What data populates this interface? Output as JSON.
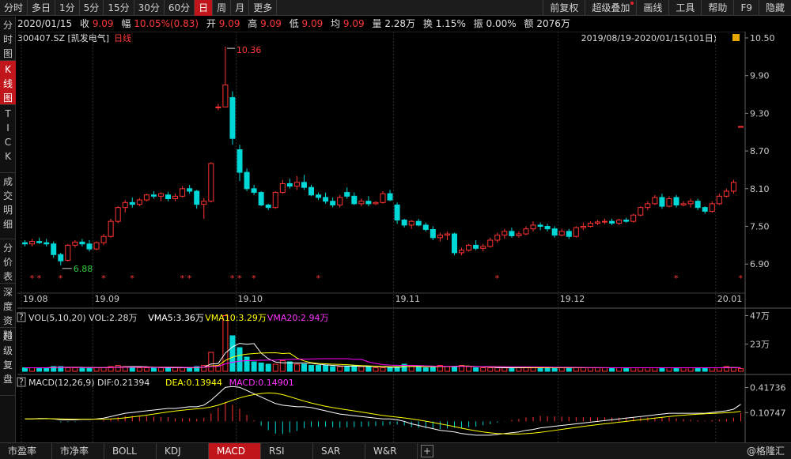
{
  "toolbar": {
    "periods": [
      "分时",
      "多日",
      "1分",
      "5分",
      "15分",
      "30分",
      "60分",
      "日",
      "周",
      "月",
      "更多"
    ],
    "active_period": "日",
    "right": [
      "前复权",
      "超级叠加",
      "画线",
      "工具",
      "帮助",
      "F9",
      "隐藏"
    ]
  },
  "left_tabs": [
    {
      "label": "分时图",
      "active": false
    },
    {
      "label": "K线图",
      "active": true
    },
    {
      "label": "TICK",
      "active": false
    },
    {
      "label": "成交明细",
      "active": false
    },
    {
      "label": "分价表",
      "active": false
    },
    {
      "label": "深度资料",
      "active": false
    },
    {
      "label": "超级复盘",
      "active": false
    }
  ],
  "info": {
    "date": "2020/01/15",
    "close_label": "收",
    "close": "9.09",
    "change_label": "幅",
    "change": "10.05%(0.83)",
    "open_label": "开",
    "open": "9.09",
    "high_label": "高",
    "high": "9.09",
    "low_label": "低",
    "low": "9.09",
    "avg_label": "均",
    "avg": "9.09",
    "vol_label": "量",
    "vol": "2.28万",
    "turnover_label": "换",
    "turnover": "1.15%",
    "amp_label": "振",
    "amp": "0.00%",
    "amount_label": "额",
    "amount": "2076万"
  },
  "stock": {
    "code": "300407.SZ",
    "name": "[凯发电气]",
    "period": "日线",
    "range": "2019/08/19-2020/01/15(101日)"
  },
  "colors": {
    "up": "#ff3333",
    "down": "#00d8d8",
    "ma5": "#ffffff",
    "ma10": "#ffff00",
    "ma20": "#ff00ff",
    "active": "#c0161b"
  },
  "chart_data": [
    {
      "type": "candlestick",
      "title": "日线",
      "yaxis_ticks": [
        "10.50",
        "9.90",
        "9.30",
        "8.70",
        "8.10",
        "7.50",
        "6.90"
      ],
      "ylim": [
        6.45,
        10.55
      ],
      "xaxis_ticks": [
        "19.08",
        "19.09",
        "19.10",
        "19.11",
        "19.12",
        "20.01"
      ],
      "annotations": [
        {
          "text": "10.36",
          "value": 10.36
        },
        {
          "text": "6.88",
          "value": 6.88
        }
      ],
      "series": [
        {
          "date": "19.08.19",
          "o": 7.24,
          "h": 7.28,
          "l": 7.18,
          "c": 7.22
        },
        {
          "date": "19.08.20",
          "o": 7.22,
          "h": 7.3,
          "l": 7.18,
          "c": 7.26
        },
        {
          "date": "19.08.21",
          "o": 7.26,
          "h": 7.32,
          "l": 7.22,
          "c": 7.24
        },
        {
          "date": "19.08.22",
          "o": 7.24,
          "h": 7.3,
          "l": 7.18,
          "c": 7.22
        },
        {
          "date": "19.08.23",
          "o": 7.22,
          "h": 7.26,
          "l": 7.0,
          "c": 7.05
        },
        {
          "date": "19.08.26",
          "o": 7.05,
          "h": 7.08,
          "l": 6.88,
          "c": 6.95
        },
        {
          "date": "19.08.27",
          "o": 6.96,
          "h": 7.22,
          "l": 6.94,
          "c": 7.2
        },
        {
          "date": "19.08.28",
          "o": 7.2,
          "h": 7.28,
          "l": 7.16,
          "c": 7.25
        },
        {
          "date": "19.08.29",
          "o": 7.25,
          "h": 7.3,
          "l": 7.18,
          "c": 7.22
        },
        {
          "date": "19.08.30",
          "o": 7.22,
          "h": 7.28,
          "l": 7.1,
          "c": 7.14
        },
        {
          "date": "19.09.02",
          "o": 7.14,
          "h": 7.26,
          "l": 7.12,
          "c": 7.24
        },
        {
          "date": "19.09.03",
          "o": 7.24,
          "h": 7.38,
          "l": 7.2,
          "c": 7.34
        },
        {
          "date": "19.09.04",
          "o": 7.34,
          "h": 7.62,
          "l": 7.32,
          "c": 7.58
        },
        {
          "date": "19.09.05",
          "o": 7.58,
          "h": 7.82,
          "l": 7.55,
          "c": 7.8
        },
        {
          "date": "19.09.06",
          "o": 7.8,
          "h": 7.92,
          "l": 7.72,
          "c": 7.88
        },
        {
          "date": "19.09.09",
          "o": 7.88,
          "h": 7.96,
          "l": 7.8,
          "c": 7.85
        },
        {
          "date": "19.09.10",
          "o": 7.85,
          "h": 7.95,
          "l": 7.82,
          "c": 7.92
        },
        {
          "date": "19.09.11",
          "o": 7.92,
          "h": 8.02,
          "l": 7.9,
          "c": 8.0
        },
        {
          "date": "19.09.12",
          "o": 8.0,
          "h": 8.06,
          "l": 7.94,
          "c": 7.98
        },
        {
          "date": "19.09.16",
          "o": 7.98,
          "h": 8.04,
          "l": 7.9,
          "c": 8.02
        },
        {
          "date": "19.09.17",
          "o": 8.0,
          "h": 8.05,
          "l": 7.9,
          "c": 7.94
        },
        {
          "date": "19.09.18",
          "o": 7.94,
          "h": 8.02,
          "l": 7.9,
          "c": 7.98
        },
        {
          "date": "19.09.19",
          "o": 7.98,
          "h": 8.14,
          "l": 7.96,
          "c": 8.1
        },
        {
          "date": "19.09.20",
          "o": 8.1,
          "h": 8.16,
          "l": 8.02,
          "c": 8.06
        },
        {
          "date": "19.09.23",
          "o": 8.06,
          "h": 8.08,
          "l": 7.78,
          "c": 7.85
        },
        {
          "date": "19.09.24",
          "o": 7.85,
          "h": 7.95,
          "l": 7.62,
          "c": 7.9
        },
        {
          "date": "19.09.25",
          "o": 7.9,
          "h": 8.52,
          "l": 7.88,
          "c": 8.5
        },
        {
          "date": "19.09.26",
          "o": 9.4,
          "h": 9.45,
          "l": 9.35,
          "c": 9.4
        },
        {
          "date": "19.09.27",
          "o": 9.4,
          "h": 10.36,
          "l": 9.4,
          "c": 9.75
        },
        {
          "date": "19.09.30",
          "o": 9.55,
          "h": 9.65,
          "l": 8.8,
          "c": 8.9
        },
        {
          "date": "19.10.08",
          "o": 8.72,
          "h": 8.8,
          "l": 8.22,
          "c": 8.36
        },
        {
          "date": "19.10.09",
          "o": 8.36,
          "h": 8.42,
          "l": 8.06,
          "c": 8.1
        },
        {
          "date": "19.10.10",
          "o": 8.1,
          "h": 8.16,
          "l": 8.0,
          "c": 8.04
        },
        {
          "date": "19.10.11",
          "o": 8.04,
          "h": 8.06,
          "l": 7.82,
          "c": 7.84
        },
        {
          "date": "19.10.14",
          "o": 7.84,
          "h": 7.86,
          "l": 7.76,
          "c": 7.8
        },
        {
          "date": "19.10.15",
          "o": 7.8,
          "h": 8.06,
          "l": 7.78,
          "c": 8.04
        },
        {
          "date": "19.10.16",
          "o": 8.04,
          "h": 8.24,
          "l": 8.02,
          "c": 8.18
        },
        {
          "date": "19.10.17",
          "o": 8.18,
          "h": 8.26,
          "l": 8.1,
          "c": 8.14
        },
        {
          "date": "19.10.18",
          "o": 8.14,
          "h": 8.3,
          "l": 8.08,
          "c": 8.2
        },
        {
          "date": "19.10.21",
          "o": 8.2,
          "h": 8.32,
          "l": 8.08,
          "c": 8.12
        },
        {
          "date": "19.10.22",
          "o": 8.12,
          "h": 8.16,
          "l": 7.98,
          "c": 8.0
        },
        {
          "date": "19.10.23",
          "o": 8.0,
          "h": 8.04,
          "l": 7.92,
          "c": 7.96
        },
        {
          "date": "19.10.24",
          "o": 7.96,
          "h": 8.04,
          "l": 7.86,
          "c": 7.9
        },
        {
          "date": "19.10.25",
          "o": 7.9,
          "h": 7.96,
          "l": 7.8,
          "c": 7.84
        },
        {
          "date": "19.10.28",
          "o": 7.84,
          "h": 8.0,
          "l": 7.8,
          "c": 7.96
        },
        {
          "date": "19.10.29",
          "o": 8.04,
          "h": 8.12,
          "l": 7.94,
          "c": 7.98
        },
        {
          "date": "19.10.30",
          "o": 7.98,
          "h": 8.04,
          "l": 7.84,
          "c": 7.86
        },
        {
          "date": "19.10.31",
          "o": 7.86,
          "h": 7.94,
          "l": 7.82,
          "c": 7.9
        },
        {
          "date": "19.11.01",
          "o": 7.9,
          "h": 7.98,
          "l": 7.82,
          "c": 7.86
        },
        {
          "date": "19.11.04",
          "o": 7.86,
          "h": 7.9,
          "l": 7.84,
          "c": 7.88
        },
        {
          "date": "19.11.05",
          "o": 7.88,
          "h": 8.06,
          "l": 7.86,
          "c": 8.02
        },
        {
          "date": "19.11.06",
          "o": 8.02,
          "h": 8.08,
          "l": 7.9,
          "c": 7.92
        },
        {
          "date": "19.11.07",
          "o": 7.84,
          "h": 7.88,
          "l": 7.54,
          "c": 7.6
        },
        {
          "date": "19.11.08",
          "o": 7.6,
          "h": 7.62,
          "l": 7.48,
          "c": 7.52
        },
        {
          "date": "19.11.11",
          "o": 7.52,
          "h": 7.6,
          "l": 7.46,
          "c": 7.58
        },
        {
          "date": "19.11.12",
          "o": 7.58,
          "h": 7.62,
          "l": 7.5,
          "c": 7.52
        },
        {
          "date": "19.11.13",
          "o": 7.52,
          "h": 7.56,
          "l": 7.42,
          "c": 7.45
        },
        {
          "date": "19.11.14",
          "o": 7.45,
          "h": 7.5,
          "l": 7.28,
          "c": 7.32
        },
        {
          "date": "19.11.15",
          "o": 7.32,
          "h": 7.4,
          "l": 7.26,
          "c": 7.36
        },
        {
          "date": "19.11.18",
          "o": 7.36,
          "h": 7.42,
          "l": 7.28,
          "c": 7.38
        },
        {
          "date": "19.11.19",
          "o": 7.38,
          "h": 7.4,
          "l": 7.04,
          "c": 7.08
        },
        {
          "date": "19.11.20",
          "o": 7.08,
          "h": 7.16,
          "l": 7.04,
          "c": 7.12
        },
        {
          "date": "19.11.21",
          "o": 7.12,
          "h": 7.22,
          "l": 7.1,
          "c": 7.2
        },
        {
          "date": "19.11.22",
          "o": 7.2,
          "h": 7.28,
          "l": 7.12,
          "c": 7.15
        },
        {
          "date": "19.11.25",
          "o": 7.15,
          "h": 7.22,
          "l": 7.1,
          "c": 7.18
        },
        {
          "date": "19.11.26",
          "o": 7.18,
          "h": 7.32,
          "l": 7.16,
          "c": 7.28
        },
        {
          "date": "19.11.27",
          "o": 7.28,
          "h": 7.4,
          "l": 7.24,
          "c": 7.36
        },
        {
          "date": "19.11.28",
          "o": 7.36,
          "h": 7.46,
          "l": 7.3,
          "c": 7.42
        },
        {
          "date": "19.11.29",
          "o": 7.42,
          "h": 7.48,
          "l": 7.32,
          "c": 7.35
        },
        {
          "date": "19.12.02",
          "o": 7.35,
          "h": 7.42,
          "l": 7.32,
          "c": 7.38
        },
        {
          "date": "19.12.03",
          "o": 7.38,
          "h": 7.5,
          "l": 7.36,
          "c": 7.46
        },
        {
          "date": "19.12.04",
          "o": 7.46,
          "h": 7.58,
          "l": 7.42,
          "c": 7.52
        },
        {
          "date": "19.12.05",
          "o": 7.52,
          "h": 7.56,
          "l": 7.44,
          "c": 7.5
        },
        {
          "date": "19.12.06",
          "o": 7.5,
          "h": 7.54,
          "l": 7.42,
          "c": 7.46
        },
        {
          "date": "19.12.09",
          "o": 7.46,
          "h": 7.5,
          "l": 7.32,
          "c": 7.36
        },
        {
          "date": "19.12.10",
          "o": 7.36,
          "h": 7.46,
          "l": 7.34,
          "c": 7.42
        },
        {
          "date": "19.12.11",
          "o": 7.42,
          "h": 7.46,
          "l": 7.3,
          "c": 7.34
        },
        {
          "date": "19.12.12",
          "o": 7.34,
          "h": 7.5,
          "l": 7.32,
          "c": 7.48
        },
        {
          "date": "19.12.13",
          "o": 7.48,
          "h": 7.56,
          "l": 7.44,
          "c": 7.5
        },
        {
          "date": "19.12.16",
          "o": 7.5,
          "h": 7.58,
          "l": 7.48,
          "c": 7.55
        },
        {
          "date": "19.12.17",
          "o": 7.55,
          "h": 7.6,
          "l": 7.52,
          "c": 7.57
        },
        {
          "date": "19.12.18",
          "o": 7.57,
          "h": 7.62,
          "l": 7.54,
          "c": 7.58
        },
        {
          "date": "19.12.19",
          "o": 7.58,
          "h": 7.62,
          "l": 7.52,
          "c": 7.55
        },
        {
          "date": "19.12.20",
          "o": 7.55,
          "h": 7.62,
          "l": 7.52,
          "c": 7.6
        },
        {
          "date": "19.12.23",
          "o": 7.6,
          "h": 7.64,
          "l": 7.56,
          "c": 7.58
        },
        {
          "date": "19.12.24",
          "o": 7.58,
          "h": 7.7,
          "l": 7.56,
          "c": 7.68
        },
        {
          "date": "19.12.25",
          "o": 7.68,
          "h": 7.82,
          "l": 7.66,
          "c": 7.8
        },
        {
          "date": "19.12.26",
          "o": 7.8,
          "h": 7.9,
          "l": 7.76,
          "c": 7.86
        },
        {
          "date": "19.12.27",
          "o": 7.86,
          "h": 8.0,
          "l": 7.84,
          "c": 7.96
        },
        {
          "date": "19.12.30",
          "o": 7.96,
          "h": 8.02,
          "l": 7.78,
          "c": 7.82
        },
        {
          "date": "19.12.31",
          "o": 7.82,
          "h": 7.98,
          "l": 7.8,
          "c": 7.94
        },
        {
          "date": "20.01.02",
          "o": 7.96,
          "h": 8.0,
          "l": 7.8,
          "c": 7.84
        },
        {
          "date": "20.01.03",
          "o": 7.84,
          "h": 7.9,
          "l": 7.82,
          "c": 7.86
        },
        {
          "date": "20.01.06",
          "o": 7.86,
          "h": 7.94,
          "l": 7.8,
          "c": 7.9
        },
        {
          "date": "20.01.07",
          "o": 7.9,
          "h": 7.94,
          "l": 7.76,
          "c": 7.8
        },
        {
          "date": "20.01.08",
          "o": 7.8,
          "h": 7.82,
          "l": 7.7,
          "c": 7.74
        },
        {
          "date": "20.01.09",
          "o": 7.74,
          "h": 7.9,
          "l": 7.72,
          "c": 7.86
        },
        {
          "date": "20.01.10",
          "o": 7.86,
          "h": 8.02,
          "l": 7.84,
          "c": 7.98
        },
        {
          "date": "20.01.13",
          "o": 7.98,
          "h": 8.1,
          "l": 7.96,
          "c": 8.06
        },
        {
          "date": "20.01.14",
          "o": 8.06,
          "h": 8.24,
          "l": 8.02,
          "c": 8.2
        },
        {
          "date": "20.01.15",
          "o": 9.09,
          "h": 9.09,
          "l": 9.09,
          "c": 9.09
        }
      ]
    },
    {
      "type": "bar",
      "title": "VOL(5,10,20)",
      "legend": [
        "VOL:2.28万",
        "VMA5:3.36万",
        "VMA10:3.29万",
        "VMA20:2.94万"
      ],
      "yaxis_ticks": [
        "47万",
        "23万"
      ],
      "ylim": [
        0,
        50
      ],
      "unit": "万",
      "values": [
        3,
        3,
        3,
        3,
        4,
        4,
        3,
        3,
        3,
        3,
        3,
        3,
        4,
        5,
        4,
        4,
        3,
        3,
        3,
        3,
        3,
        3,
        3,
        3,
        4,
        5,
        16,
        5,
        47,
        30,
        20,
        12,
        8,
        7,
        6,
        6,
        9,
        8,
        6,
        6,
        5,
        5,
        5,
        4,
        4,
        4,
        5,
        4,
        4,
        3,
        3,
        3,
        4,
        6,
        5,
        4,
        3,
        4,
        5,
        4,
        4,
        5,
        4,
        3,
        3,
        3,
        3,
        3,
        3,
        3,
        3,
        3,
        3,
        3,
        3,
        3,
        3,
        3,
        3,
        3,
        3,
        3,
        3,
        3,
        3,
        3,
        3,
        3,
        3,
        3,
        3,
        3,
        3,
        3,
        3,
        3,
        3,
        3,
        4,
        3,
        2.28
      ]
    },
    {
      "type": "line",
      "title": "MACD(12,26,9)",
      "legend": [
        "DIF:0.21394",
        "DEA:0.13944",
        "MACD:0.14901"
      ],
      "yaxis_ticks": [
        "0.41736",
        "0.10747"
      ],
      "ylim": [
        -0.22,
        0.5
      ],
      "macd_start": [
        0.03,
        0.03,
        0.035,
        0.035,
        0.03,
        0.02,
        0.02,
        0.02,
        0.025,
        0.025,
        0.03,
        0.04,
        0.06,
        0.08,
        0.1,
        0.11,
        0.12,
        0.13,
        0.14,
        0.15,
        0.16,
        0.16,
        0.17,
        0.18,
        0.18,
        0.2,
        0.26,
        0.34,
        0.42,
        0.43,
        0.42,
        0.38,
        0.34,
        0.3,
        0.26,
        0.22,
        0.2,
        0.19,
        0.18,
        0.18,
        0.17,
        0.15,
        0.13,
        0.11,
        0.09,
        0.08,
        0.07,
        0.06,
        0.05,
        0.04,
        0.03,
        0.03,
        0.02,
        0.0,
        -0.03,
        -0.05,
        -0.07,
        -0.09,
        -0.11,
        -0.12,
        -0.13,
        -0.15,
        -0.16,
        -0.17,
        -0.17,
        -0.17,
        -0.16,
        -0.15,
        -0.14,
        -0.13,
        -0.11,
        -0.1,
        -0.08,
        -0.07,
        -0.06,
        -0.05,
        -0.04,
        -0.03,
        -0.02,
        -0.01,
        0.0,
        0.01,
        0.02,
        0.03,
        0.04,
        0.05,
        0.06,
        0.07,
        0.08,
        0.09,
        0.1,
        0.1,
        0.1,
        0.1,
        0.1,
        0.1,
        0.11,
        0.12,
        0.13,
        0.15,
        0.21
      ]
    }
  ],
  "bottom_tabs": [
    "市盈率",
    "市净率",
    "BOLL",
    "KDJ",
    "MACD",
    "RSI",
    "SAR",
    "W&R"
  ],
  "active_bottom_tab": "MACD",
  "plus_label": "+",
  "watermark": "@格隆汇",
  "ind_icon": "?"
}
